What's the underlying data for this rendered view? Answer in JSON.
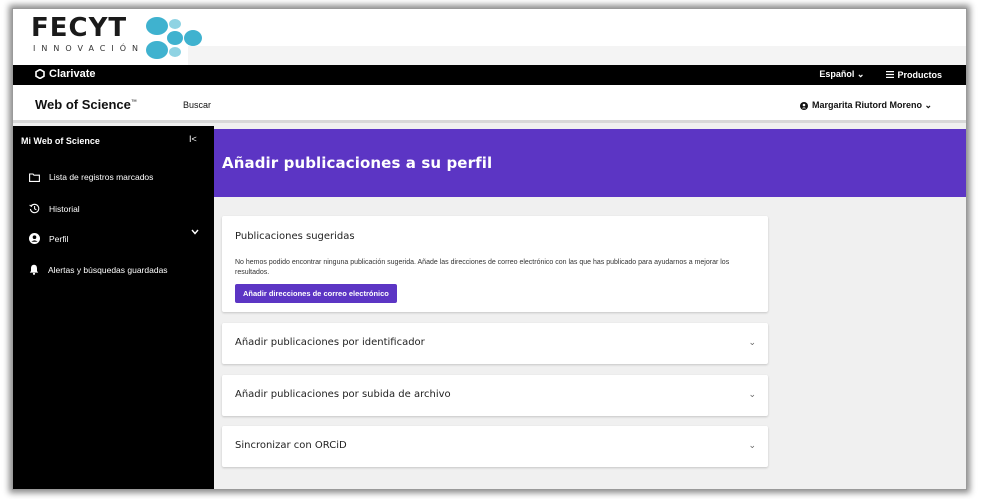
{
  "fecyt": {
    "name": "FECYT",
    "subtitle": "INNOVACIÓN"
  },
  "topbar": {
    "brand": "Clarivate",
    "language": "Español ⌄",
    "products": "Productos"
  },
  "header": {
    "title": "Web of Science",
    "title_mark": "™",
    "search": "Buscar",
    "user": "Margarita Riutord Moreno ⌄"
  },
  "sidebar": {
    "title": "Mi Web of Science",
    "collapse": "I<",
    "items": [
      {
        "label": "Lista de registros marcados",
        "icon": "folder-icon"
      },
      {
        "label": "Historial",
        "icon": "history-icon"
      },
      {
        "label": "Perfil",
        "icon": "user-icon"
      },
      {
        "label": "Alertas y búsquedas guardadas",
        "icon": "bell-icon"
      }
    ]
  },
  "main": {
    "banner_title": "Añadir publicaciones a su perfil",
    "suggested": {
      "title": "Publicaciones sugeridas",
      "text": "No hemos podido encontrar ninguna publicación sugerida. Añade las direcciones de correo electrónico con las que has publicado para ayudarnos a mejorar los resultados.",
      "button": "Añadir direcciones de correo electrónico"
    },
    "sections": [
      {
        "title": "Añadir publicaciones por identificador"
      },
      {
        "title": "Añadir publicaciones por subida de archivo"
      },
      {
        "title": "Sincronizar con ORCiD"
      }
    ],
    "chevron": "⌄"
  },
  "colors": {
    "accent": "#5c35c4",
    "sidebar_bg": "#000000",
    "page_bg": "#f0f0f0",
    "fecyt_teal": "#3fb2cf"
  }
}
